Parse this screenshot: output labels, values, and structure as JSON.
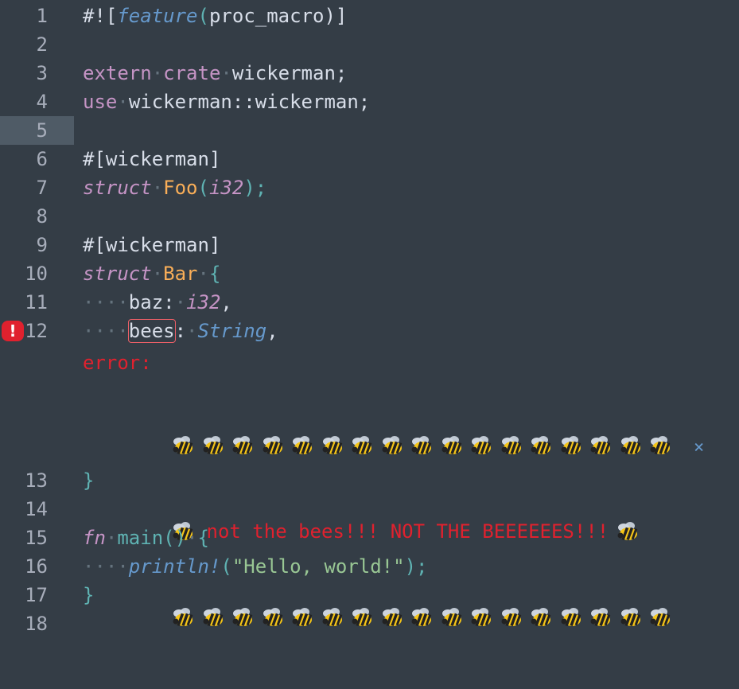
{
  "editor": {
    "lines": [
      {
        "n": "1"
      },
      {
        "n": "2"
      },
      {
        "n": "3"
      },
      {
        "n": "4"
      },
      {
        "n": "5"
      },
      {
        "n": "6"
      },
      {
        "n": "7"
      },
      {
        "n": "8"
      },
      {
        "n": "9"
      },
      {
        "n": "10"
      },
      {
        "n": "11"
      },
      {
        "n": "12"
      },
      {
        "n": "13"
      },
      {
        "n": "14"
      },
      {
        "n": "15"
      },
      {
        "n": "16"
      },
      {
        "n": "17"
      },
      {
        "n": "18"
      }
    ],
    "tokens": {
      "l1_hash": "#![",
      "l1_feature": "feature",
      "l1_open": "(",
      "l1_arg": "proc_macro",
      "l1_close": ")]",
      "l3_extern": "extern",
      "l3_crate": "crate",
      "l3_name": "wickerman",
      "l3_semi": ";",
      "l4_use": "use",
      "l4_path": "wickerman::wickerman",
      "l4_semi": ";",
      "l6_attr": "#[wickerman]",
      "l7_struct": "struct",
      "l7_name": "Foo",
      "l7_open": "(",
      "l7_type": "i32",
      "l7_close": ");",
      "l9_attr": "#[wickerman]",
      "l10_struct": "struct",
      "l10_name": "Bar",
      "l10_brace": "{",
      "l11_field": "baz",
      "l11_colon": ":",
      "l11_type": "i32",
      "l11_comma": ",",
      "l12_field": "bees",
      "l12_colon": ":",
      "l12_type": "String",
      "l12_comma": ",",
      "l13_brace": "}",
      "l15_fn": "fn",
      "l15_name": "main",
      "l15_parens": "()",
      "l15_brace": "{",
      "l16_macro": "println!",
      "l16_open": "(",
      "l16_str": "\"Hello, world!\"",
      "l16_close": ");",
      "l17_brace": "}"
    },
    "whitespace_dot": "·",
    "indent_dots": "····"
  },
  "error": {
    "label": "error:",
    "message": "not the bees!!! NOT THE BEEEEEES!!!",
    "bee_count_per_row": 17,
    "close_glyph": "×",
    "icon_glyph": "!"
  },
  "colors": {
    "background": "#343d46",
    "active_line_gutter": "#4f5b66",
    "error_red": "#e0212e",
    "keyword": "#c594c5",
    "type_name": "#f9ae58",
    "string": "#99c794",
    "punctuation": "#5fb3b3",
    "function": "#6699cc"
  }
}
